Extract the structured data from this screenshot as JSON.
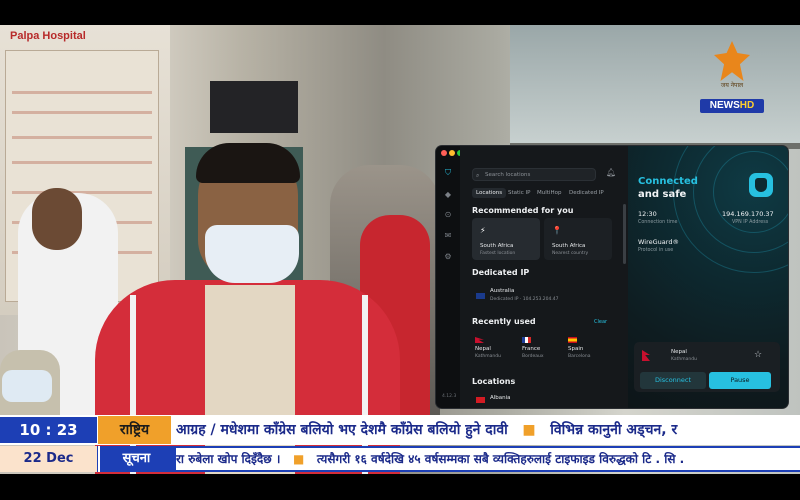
{
  "scene": {
    "hospital_sign": "Palpa Hospital"
  },
  "channel": {
    "logo_sub": "जय नेपाल",
    "logo_news": "NEWS",
    "logo_hd": "HD"
  },
  "vpn": {
    "version": "4.12.3",
    "search_placeholder": "Search locations",
    "tabs": [
      "Locations",
      "Static IP",
      "MultiHop",
      "Dedicated IP"
    ],
    "recommended_title": "Recommended for you",
    "recommended": [
      {
        "name": "South Africa",
        "sub": "Fastest location",
        "icon": "⚡"
      },
      {
        "name": "South Africa",
        "sub": "Nearest country",
        "icon": "📍"
      }
    ],
    "dedicated_title": "Dedicated IP",
    "dedicated": {
      "name": "Australia",
      "sub": "Dedicated IP · 104.253.204.47"
    },
    "recent_title": "Recently used",
    "clear_label": "Clear",
    "recent": [
      {
        "name": "Nepal",
        "sub": "Kathmandu"
      },
      {
        "name": "France",
        "sub": "Bordeaux"
      },
      {
        "name": "Spain",
        "sub": "Barcelona"
      }
    ],
    "locations_title": "Locations",
    "locations_first": "Albania",
    "status_line1": "Connected",
    "status_line2": "and safe",
    "connection_time": "12:30",
    "connection_time_label": "Connection time",
    "vpn_ip": "194.169.170.37",
    "vpn_ip_label": "VPN IP Address",
    "protocol": "WireGuard®",
    "protocol_label": "Protocol in use",
    "current_location": {
      "name": "Nepal",
      "sub": "Kathmandu"
    },
    "disconnect_label": "Disconnect",
    "pause_label": "Pause"
  },
  "ticker": {
    "time": "10 : 23",
    "category1": "राष्ट्रिय",
    "headline1_a": "आग्रह / मधेशमा काँग्रेस बलियो भए देशमै काँग्रेस बलियो हुने दावी",
    "headline1_b": "विभिन्न कानुनी अड्चन, र",
    "date": "22 Dec",
    "category2": "सूचना",
    "headline2_a": "रा रुबेला खोप दिइँदैछ ।",
    "headline2_b": "त्यसैगरी १६ वर्षदेखि ४५ वर्षसम्मका सबै व्यक्तिहरुलाई टाइफाइड विरुद्धको टि . सि ."
  },
  "colors": {
    "accent": "#27c0e0",
    "ticker_blue": "#1d3fb5",
    "ticker_orange": "#f0a02a"
  }
}
